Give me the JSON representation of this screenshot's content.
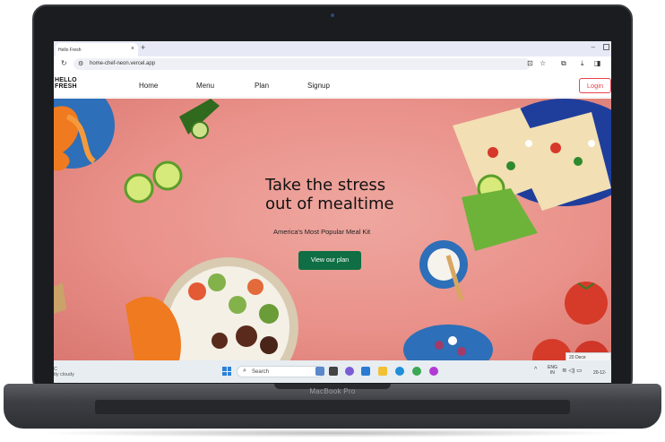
{
  "device": {
    "brand": "MacBook Pro"
  },
  "browser": {
    "tab_title": "Hello Fresh",
    "tab_close": "×",
    "new_tab": "+",
    "url": "home-chef-neon.vercel.app"
  },
  "site": {
    "logo_line1": "HELLO",
    "logo_line2": "FRESH",
    "nav": [
      "Home",
      "Menu",
      "Plan",
      "Signup"
    ],
    "login_label": "Login",
    "hero": {
      "headline_line1": "Take the stress",
      "headline_line2": "out of mealtime",
      "subtitle": "America's Most Popular Meal Kit",
      "cta_label": "View our plan"
    },
    "colors": {
      "accent": "#e9434b",
      "cta": "#0f6e43",
      "hero_bg": "#e98f87"
    }
  },
  "taskbar": {
    "weather_temp": "C",
    "weather_text": "tly cloudy",
    "search_placeholder": "Search",
    "lang_line1": "ENG",
    "lang_line2": "IN",
    "clock": "20-12-",
    "date_popup": "20 Dece"
  }
}
